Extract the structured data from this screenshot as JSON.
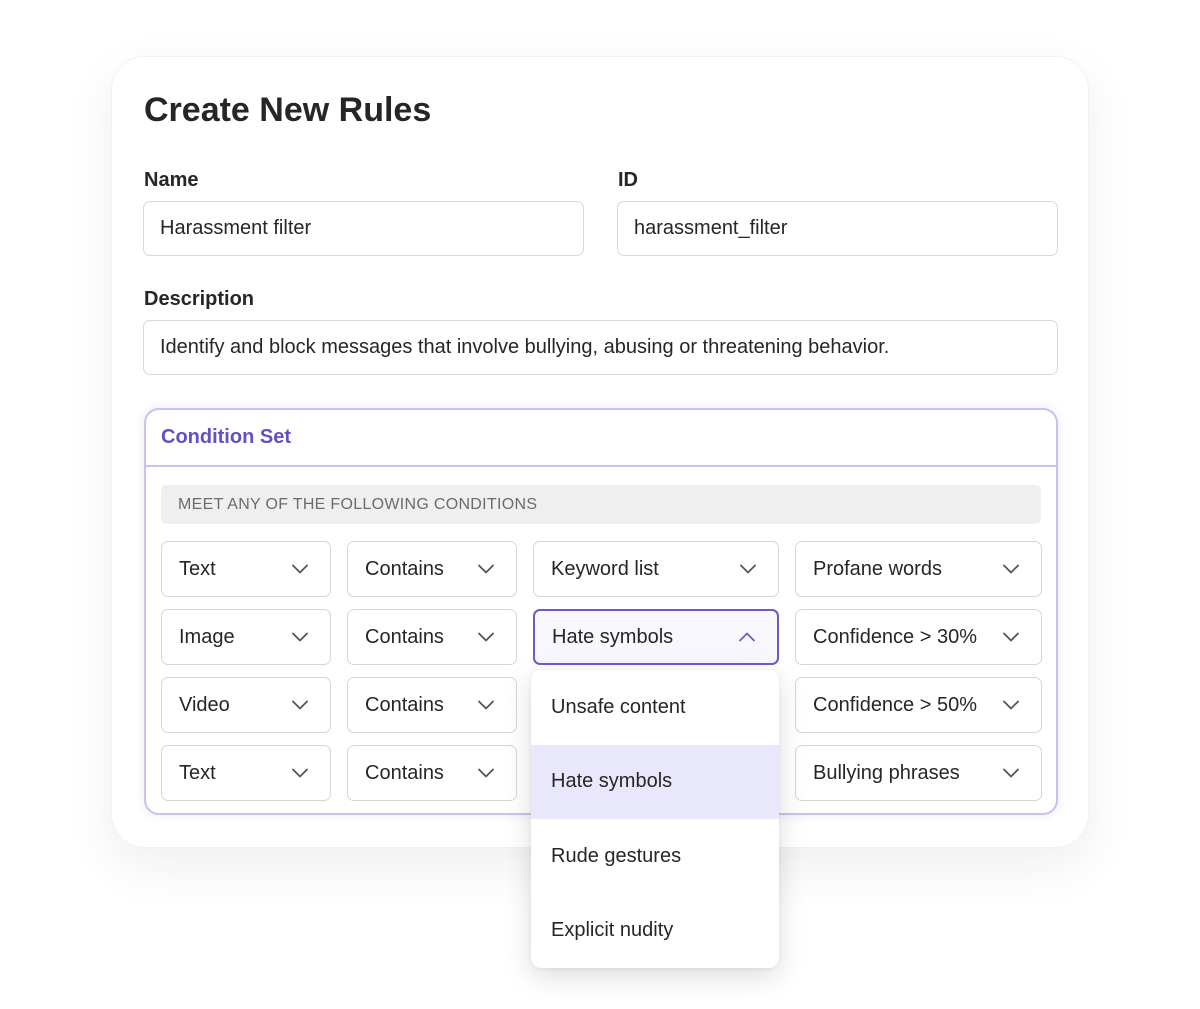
{
  "page": {
    "title": "Create New Rules"
  },
  "form": {
    "name_label": "Name",
    "name_value": "Harassment filter",
    "id_label": "ID",
    "id_value": "harassment_filter",
    "description_label": "Description",
    "description_value": "Identify and block messages that involve bullying, abusing or threatening behavior."
  },
  "condition_set": {
    "title": "Condition Set",
    "match_label": "MEET ANY OF THE FOLLOWING CONDITIONS",
    "rows": [
      {
        "type": "Text",
        "operator": "Contains",
        "source": "Keyword list",
        "value": "Profane words"
      },
      {
        "type": "Image",
        "operator": "Contains",
        "source": "Hate symbols",
        "value": "Confidence > 30%"
      },
      {
        "type": "Video",
        "operator": "Contains",
        "source": "",
        "value": "Confidence > 50%"
      },
      {
        "type": "Text",
        "operator": "Contains",
        "source": "",
        "value": "Bullying phrases"
      }
    ]
  },
  "dropdown_menu": {
    "options": [
      "Unsafe content",
      "Hate symbols",
      "Rude gestures",
      "Explicit nudity"
    ],
    "selected": "Hate symbols"
  },
  "colors": {
    "accent": "#6350c5",
    "accent_border": "#c8c2ee",
    "selected_option_bg": "#e9e7fb",
    "text": "#262626"
  },
  "icons": {
    "dropdown_closed": "chevron-down-icon",
    "dropdown_open": "chevron-up-icon"
  }
}
